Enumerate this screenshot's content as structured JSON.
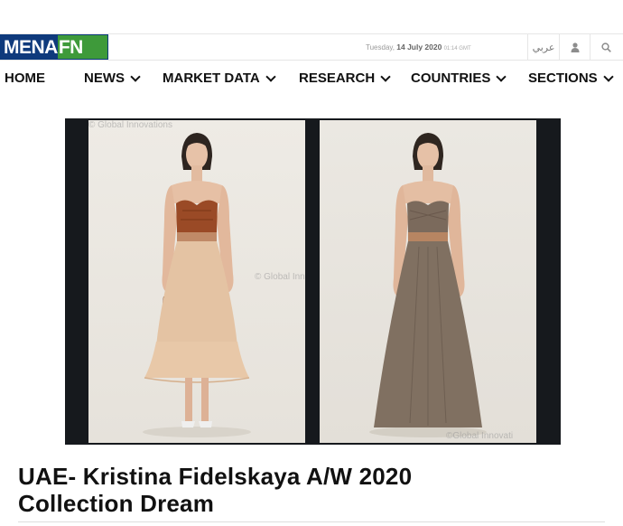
{
  "brand": {
    "part1": "MENA",
    "part2": "FN"
  },
  "topbar": {
    "day": "Tuesday,",
    "date": "14 July 2020",
    "time": "01:14 GMT",
    "lang": "عربي",
    "icons": [
      "user-icon",
      "search-icon"
    ]
  },
  "nav": {
    "items": [
      {
        "label": "HOME"
      },
      {
        "label": "NEWS"
      },
      {
        "label": "MARKET DATA"
      },
      {
        "label": "RESEARCH"
      },
      {
        "label": "COUNTRIES"
      },
      {
        "label": "SECTIONS"
      }
    ]
  },
  "hero": {
    "watermark_top": "© Global Innovations",
    "watermark_mid": "© Global Innovations",
    "watermark_bottom": "©Global Innovati"
  },
  "article": {
    "title_line1": "UAE- Kristina Fidelskaya A/W 2020",
    "title_line2": "Collection Dream"
  },
  "colors": {
    "brand_blue": "#0f3a7c",
    "brand_green": "#3e9a3a"
  }
}
